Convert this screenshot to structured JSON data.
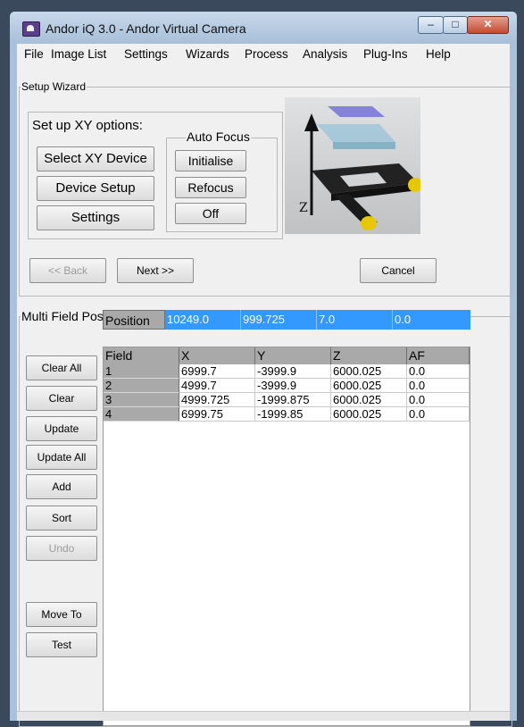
{
  "window": {
    "title": "Andor iQ 3.0  - Andor Virtual Camera",
    "minimize": "–",
    "maximize": "□",
    "close": "✕"
  },
  "menu": [
    "File",
    "Image List",
    "Settings",
    "Wizards",
    "Process",
    "Analysis",
    "Plug-Ins",
    "Help"
  ],
  "setup_wizard": {
    "group_label": "Setup Wizard",
    "xy_options_label": "Set up XY options:",
    "select_xy_device": "Select XY Device",
    "device_setup": "Device Setup",
    "settings": "Settings",
    "autofocus": {
      "label": "Auto Focus",
      "initialise": "Initialise",
      "refocus": "Refocus",
      "off": "Off"
    },
    "image_axis_label": "Z",
    "back": "<< Back",
    "next": "Next >>",
    "cancel": "Cancel"
  },
  "multi_field": {
    "group_label": "Multi Field Positions",
    "position": {
      "label": "Position",
      "values": [
        "10249.0",
        "999.725",
        "7.0",
        "0.0"
      ]
    },
    "columns": [
      "Field",
      "X",
      "Y",
      "Z",
      "AF"
    ],
    "rows": [
      [
        "1",
        "6999.7",
        "-3999.9",
        "6000.025",
        "0.0"
      ],
      [
        "2",
        "4999.7",
        "-3999.9",
        "6000.025",
        "0.0"
      ],
      [
        "3",
        "4999.725",
        "-1999.875",
        "6000.025",
        "0.0"
      ],
      [
        "4",
        "6999.75",
        "-1999.85",
        "6000.025",
        "0.0"
      ]
    ],
    "buttons": {
      "clear_all": "Clear All",
      "clear": "Clear",
      "update": "Update",
      "update_all": "Update All",
      "add": "Add",
      "sort": "Sort",
      "undo": "Undo",
      "move_to": "Move To",
      "test": "Test"
    }
  },
  "colors": {
    "selection": "#3399ff",
    "header_gray": "#a9a9a9"
  }
}
